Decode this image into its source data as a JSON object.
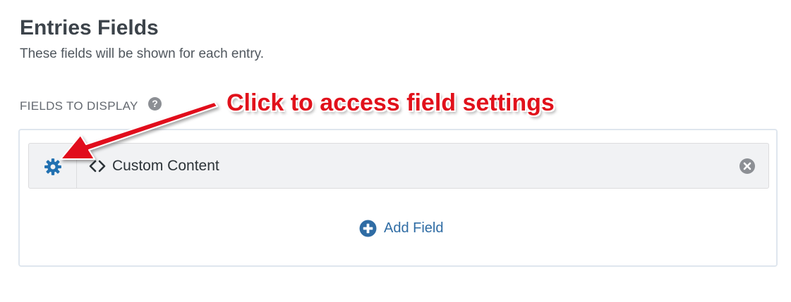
{
  "header": {
    "title": "Entries Fields",
    "description": "These fields will be shown for each entry."
  },
  "section": {
    "label": "FIELDS TO DISPLAY",
    "help_icon": "question-circle-icon"
  },
  "fields": [
    {
      "name": "Custom Content",
      "settings_icon": "gear-icon",
      "type_icon": "code-icon",
      "remove_icon": "remove-circle-icon"
    }
  ],
  "add_field": {
    "label": "Add Field",
    "icon": "plus-circle-icon"
  },
  "annotation": {
    "text": "Click to access field settings",
    "color": "#e1111b"
  },
  "colors": {
    "link": "#2f6ca4",
    "gear": "#2271b1",
    "row_background": "#f1f2f4"
  }
}
